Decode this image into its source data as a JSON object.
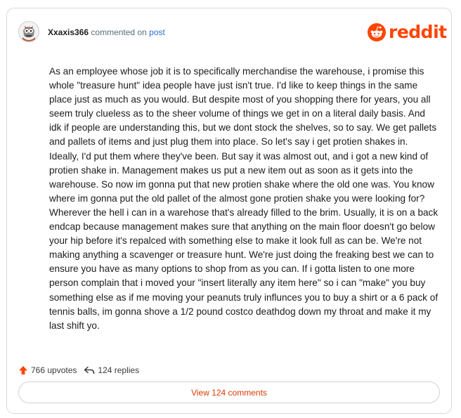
{
  "comment": {
    "author": "Xxaxis366",
    "action_text": "commented on",
    "post_link_text": "post",
    "body": "As an employee whose job it is to specifically merchandise the warehouse, i promise this whole \"treasure hunt\" idea people have just isn't true. I'd like to keep things in the same place just as much as you would. But despite most of you shopping there for years, you all seem truly clueless as to the sheer volume of things we get in on a literal daily basis. And idk if people are understanding this, but we dont stock the shelves, so to say. We get pallets and pallets of items and just plug them into place. So let's say i get protien shakes in. Ideally, I'd put them where they've been. But say it was almost out, and i got a new kind of protien shake in. Management makes us put a new item out as soon as it gets into the warehouse. So now im gonna put that new protien shake where the old one was. You know where im gonna put the old pallet of the almost gone protien shake you were looking for? Wherever the hell i can in a warehose that's already filled to the brim. Usually, it is on a back endcap because management makes sure that anything on the main floor doesn't go below your hip before it's repalced with something else to make it look full as can be. We're not making anything a scavenger or treasure hunt. We're just doing the freaking best we can to ensure you have as many options to shop from as you can. If i gotta listen to one more person complain that i moved your \"insert literally any item here\" so i can \"make\" you buy something else as if me moving your peanuts truly influnces you to buy a shirt or a 6 pack of tennis balls, im gonna shove a 1/2 pound costco deathdog down my throat and make it my last shift yo.",
    "upvotes": "766 upvotes",
    "replies": "124 replies"
  },
  "brand": {
    "logo_text": "reddit",
    "color": "#ff4500"
  },
  "actions": {
    "view_comments_label": "View 124 comments"
  },
  "icons": {
    "upvote": "upvote-arrow-icon",
    "reply": "reply-arrow-icon",
    "logo": "reddit-snoo-icon",
    "avatar": "user-avatar"
  },
  "colors": {
    "link": "#2a6bd8",
    "upvote": "#ff4500",
    "view_button_text": "#d93a00",
    "border": "#d7d9db"
  }
}
